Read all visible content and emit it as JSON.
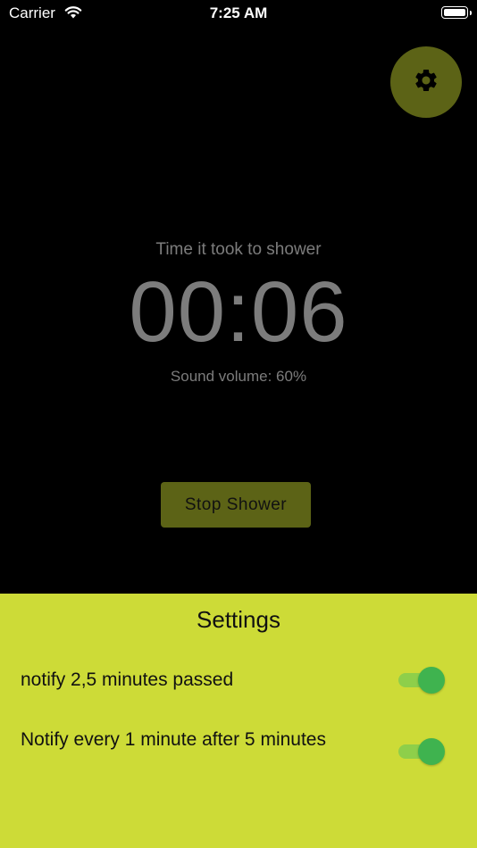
{
  "status_bar": {
    "carrier": "Carrier",
    "time": "7:25 AM"
  },
  "settings_button": {
    "icon": "gear-icon"
  },
  "timer": {
    "caption": "Time it took to shower",
    "value": "00:06",
    "volume_text": "Sound volume: 60%"
  },
  "stop_button": {
    "label": "Stop Shower"
  },
  "settings": {
    "title": "Settings",
    "options": [
      {
        "label": "notify 2,5 minutes passed",
        "enabled": true
      },
      {
        "label": "Notify every 1 minute after 5 minutes",
        "enabled": true
      }
    ]
  },
  "colors": {
    "background": "#000000",
    "accent_dark": "#5c6316",
    "panel": "#cddb37",
    "toggle_on": "#3fb34f"
  }
}
